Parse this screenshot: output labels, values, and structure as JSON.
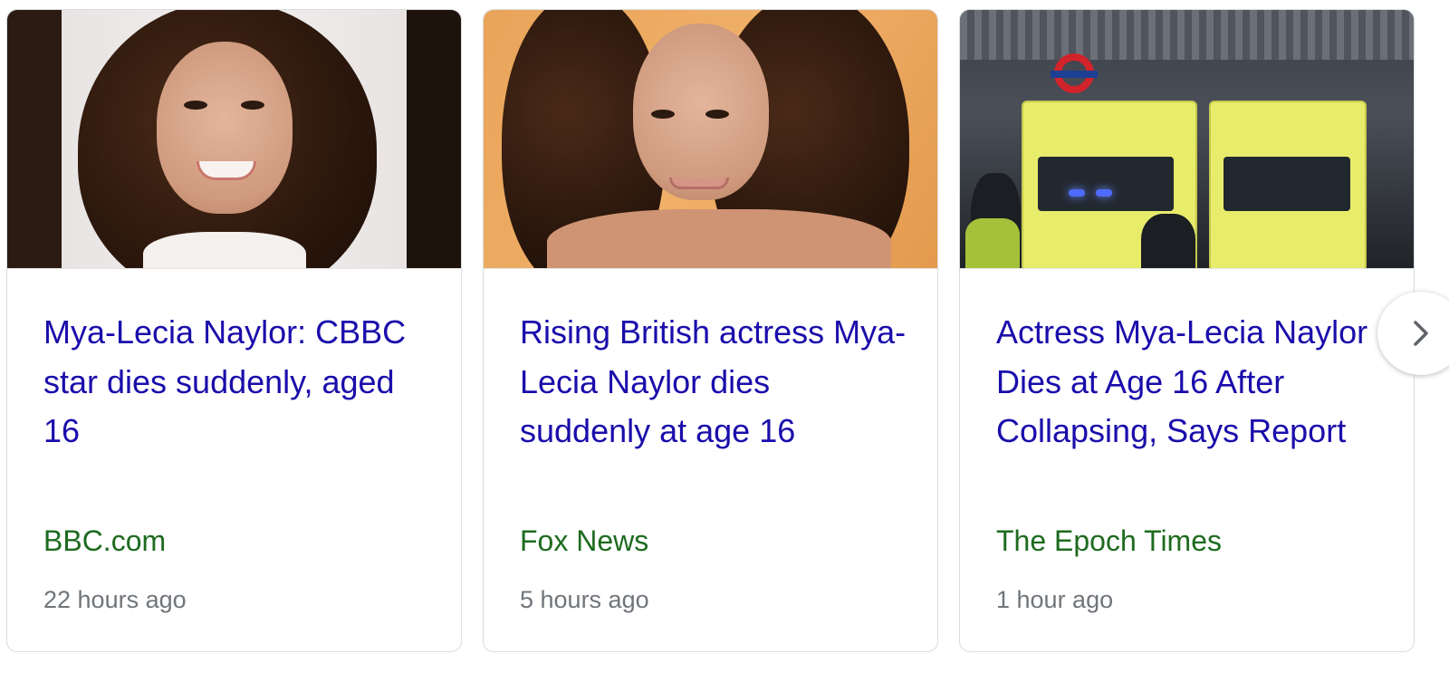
{
  "news_carousel": {
    "cards": [
      {
        "title": "Mya-Lecia Naylor: CBBC star dies suddenly, aged 16",
        "source": "BBC.com",
        "time": "22 hours ago",
        "image_icon": "portrait-photo"
      },
      {
        "title": "Rising British actress Mya-Lecia Naylor dies suddenly at age 16",
        "source": "Fox News",
        "time": "5 hours ago",
        "image_icon": "portrait-photo"
      },
      {
        "title": "Actress Mya-Lecia Naylor Dies at Age 16 After Collapsing, Says Report",
        "source": "The Epoch Times",
        "time": "1 hour ago",
        "image_icon": "ambulance-photo"
      }
    ],
    "next_button_icon": "chevron-right-icon"
  },
  "colors": {
    "title_link": "#1a0dab",
    "source": "#1e6b1f",
    "timestamp": "#70757a",
    "card_border": "#dadce0"
  }
}
